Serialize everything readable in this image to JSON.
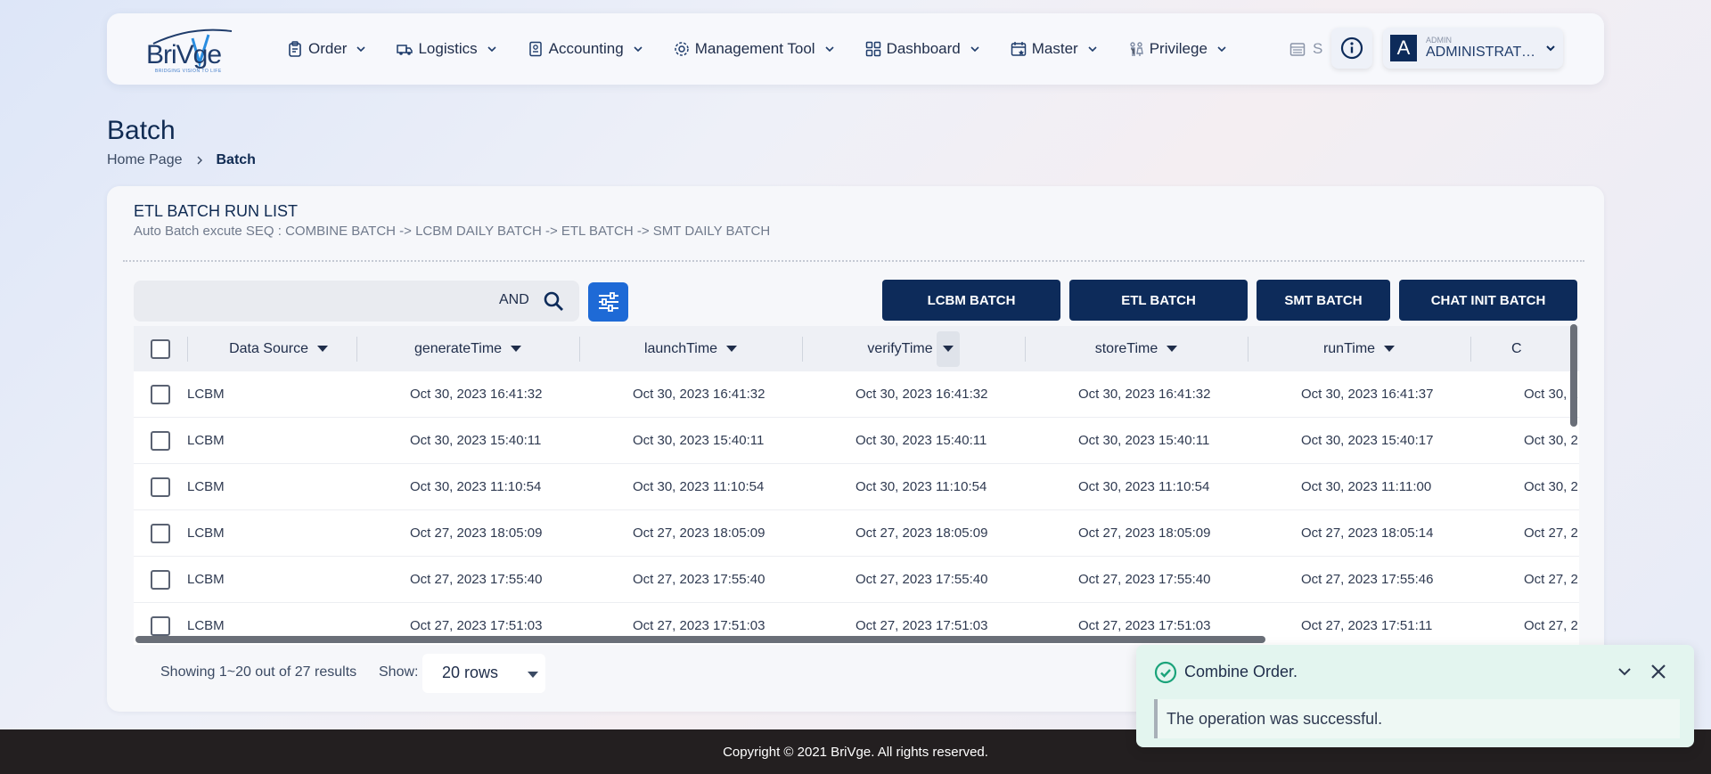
{
  "brand": {
    "logo_text": "BriVge",
    "tagline": "BRIDGING VISION TO LIFE"
  },
  "nav": {
    "items": [
      {
        "label": "Order",
        "icon": "clipboard-icon"
      },
      {
        "label": "Logistics",
        "icon": "truck-icon"
      },
      {
        "label": "Accounting",
        "icon": "document-icon"
      },
      {
        "label": "Management Tool",
        "icon": "gear-icon"
      },
      {
        "label": "Dashboard",
        "icon": "grid-icon"
      },
      {
        "label": "Master",
        "icon": "calendar-star-icon"
      },
      {
        "label": "Privilege",
        "icon": "people-icon"
      },
      {
        "label": "S",
        "icon": "calendar-icon"
      }
    ],
    "next_icon": "chevron-right-icon",
    "info_icon": "info-icon"
  },
  "user": {
    "avatar_letter": "A",
    "role": "ADMIN",
    "name": "ADMINISTRATO..."
  },
  "page": {
    "title": "Batch",
    "breadcrumb": {
      "home": "Home Page",
      "current": "Batch"
    }
  },
  "card": {
    "title": "ETL BATCH RUN LIST",
    "subtitle": "Auto Batch excute SEQ : COMBINE BATCH -> LCBM DAILY BATCH -> ETL BATCH -> SMT DAILY BATCH"
  },
  "search": {
    "placeholder": "",
    "operator": "AND"
  },
  "actions": [
    "LCBM BATCH",
    "ETL BATCH",
    "SMT BATCH",
    "CHAT INIT BATCH"
  ],
  "table": {
    "columns": [
      "Data Source",
      "generateTime",
      "launchTime",
      "verifyTime",
      "storeTime",
      "runTime",
      "C"
    ],
    "rows": [
      [
        "LCBM",
        "Oct 30, 2023 16:41:32",
        "Oct 30, 2023 16:41:32",
        "Oct 30, 2023 16:41:32",
        "Oct 30, 2023 16:41:32",
        "Oct 30, 2023 16:41:37",
        "Oct 30, 2"
      ],
      [
        "LCBM",
        "Oct 30, 2023 15:40:11",
        "Oct 30, 2023 15:40:11",
        "Oct 30, 2023 15:40:11",
        "Oct 30, 2023 15:40:11",
        "Oct 30, 2023 15:40:17",
        "Oct 30, 2"
      ],
      [
        "LCBM",
        "Oct 30, 2023 11:10:54",
        "Oct 30, 2023 11:10:54",
        "Oct 30, 2023 11:10:54",
        "Oct 30, 2023 11:10:54",
        "Oct 30, 2023 11:11:00",
        "Oct 30, 2"
      ],
      [
        "LCBM",
        "Oct 27, 2023 18:05:09",
        "Oct 27, 2023 18:05:09",
        "Oct 27, 2023 18:05:09",
        "Oct 27, 2023 18:05:09",
        "Oct 27, 2023 18:05:14",
        "Oct 27, 2"
      ],
      [
        "LCBM",
        "Oct 27, 2023 17:55:40",
        "Oct 27, 2023 17:55:40",
        "Oct 27, 2023 17:55:40",
        "Oct 27, 2023 17:55:40",
        "Oct 27, 2023 17:55:46",
        "Oct 27, 2"
      ],
      [
        "LCBM",
        "Oct 27, 2023 17:51:03",
        "Oct 27, 2023 17:51:03",
        "Oct 27, 2023 17:51:03",
        "Oct 27, 2023 17:51:03",
        "Oct 27, 2023 17:51:11",
        "Oct 27, 2"
      ]
    ]
  },
  "pagination": {
    "summary": "Showing 1~20 out of 27 results",
    "show_label": "Show:",
    "rows_option": "20 rows"
  },
  "toast": {
    "title": "Combine Order.",
    "message": "The operation was successful."
  },
  "footer": {
    "copyright": "Copyright © 2021 BriVge. All rights reserved."
  },
  "colors": {
    "primary": "#0d2b5a",
    "accent_blue": "#1e6ad6",
    "toast_bg": "#e3f5ef",
    "success": "#1aa37a",
    "footer_bg": "#231f20"
  }
}
